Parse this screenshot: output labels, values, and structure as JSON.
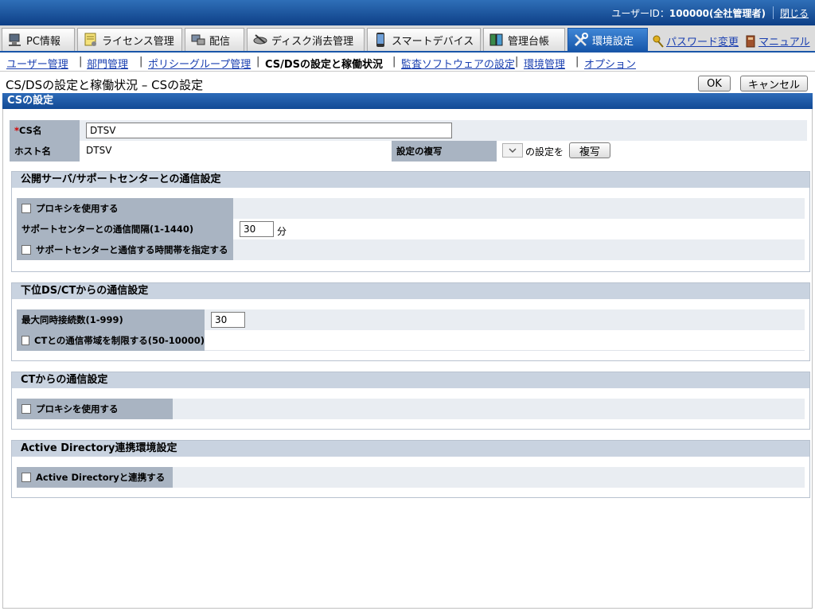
{
  "header": {
    "user_prefix": "ユーザーID：",
    "user_id": "100000(全社管理者)",
    "close_label": "閉じる"
  },
  "tabs": [
    {
      "label": "PC情報",
      "icon": "pc-icon"
    },
    {
      "label": "ライセンス管理",
      "icon": "license-icon"
    },
    {
      "label": "配信",
      "icon": "distribution-icon"
    },
    {
      "label": "ディスク消去管理",
      "icon": "disk-erase-icon"
    },
    {
      "label": "スマートデバイス",
      "icon": "smart-device-icon"
    },
    {
      "label": "管理台帳",
      "icon": "ledger-icon"
    },
    {
      "label": "環境設定",
      "icon": "tools-icon",
      "active": true
    }
  ],
  "top_links": {
    "password": "パスワード変更",
    "manual": "マニュアル"
  },
  "subnav": {
    "items": [
      "ユーザー管理",
      "部門管理",
      "ポリシーグループ管理",
      "CS/DSの設定と稼働状況",
      "監査ソフトウェアの設定",
      "環境管理",
      "オプション"
    ],
    "current_index": 3
  },
  "page": {
    "title": "CS/DSの設定と稼働状況 – CSの設定",
    "ok_label": "OK",
    "cancel_label": "キャンセル",
    "section_title": "CSの設定"
  },
  "cs": {
    "required_mark": "*",
    "name_label": "CS名",
    "name_value": "DTSV",
    "host_label": "ホスト名",
    "host_value": "DTSV",
    "copy_label": "設定の複写",
    "copy_suffix": "の設定を",
    "copy_button": "複写"
  },
  "support_group": {
    "title": "公開サーバ/サポートセンターとの通信設定",
    "use_proxy": "プロキシを使用する",
    "interval_label": "サポートセンターとの通信間隔(1-1440)",
    "interval_value": "30",
    "interval_unit": "分",
    "time_band_label": "サポートセンターと通信する時間帯を指定する"
  },
  "ds_group": {
    "title": "下位DS/CTからの通信設定",
    "max_conn_label": "最大同時接続数(1-999)",
    "max_conn_value": "30",
    "bandwidth_label": "CTとの通信帯域を制限する(50-10000)"
  },
  "ct_group": {
    "title": "CTからの通信設定",
    "use_proxy": "プロキシを使用する"
  },
  "ad_group": {
    "title": "Active Directory連携環境設定",
    "link_label": "Active Directoryと連携する"
  },
  "colors": {
    "accent": "#1a56a8",
    "label_bg": "#a9b4c2",
    "group_title_bg": "#c9d3e0"
  }
}
